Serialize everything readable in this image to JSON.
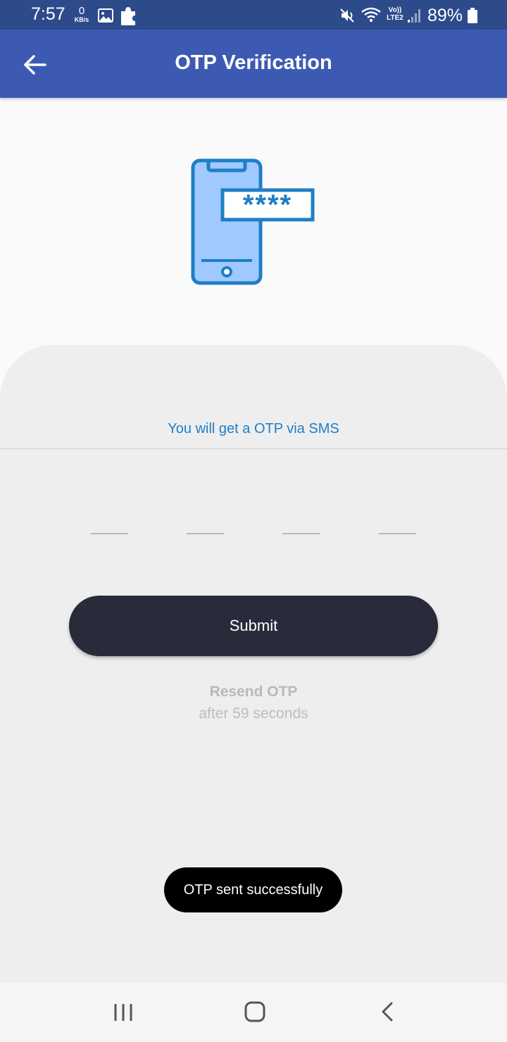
{
  "status_bar": {
    "time": "7:57",
    "net_speed_value": "0",
    "net_speed_unit": "KB/s",
    "network_type_top": "Vo))",
    "network_type_bottom": "LTE2",
    "battery_percent": "89%",
    "icons": [
      "gallery-icon",
      "puzzle-icon",
      "mute-icon",
      "wifi-icon",
      "signal-icon",
      "battery-icon"
    ]
  },
  "app_bar": {
    "title": "OTP Verification",
    "back_icon": "arrow-left-icon",
    "background_color": "#3d5ab3"
  },
  "illustration": {
    "icon": "phone-password-icon",
    "password_mask": "****"
  },
  "form": {
    "info_text": "You will get a OTP via SMS",
    "otp_digits": [
      "",
      "",
      "",
      ""
    ],
    "submit_label": "Submit",
    "resend_title": "Resend OTP",
    "resend_subtitle": "after 59 seconds"
  },
  "toast": {
    "message": "OTP sent successfully"
  },
  "nav_bar": {
    "icons": [
      "recent-apps-icon",
      "home-icon",
      "back-nav-icon"
    ]
  },
  "colors": {
    "accent": "#1f7ec6",
    "submit_button": "#292b3b",
    "status_bar": "#2d4a8b"
  }
}
